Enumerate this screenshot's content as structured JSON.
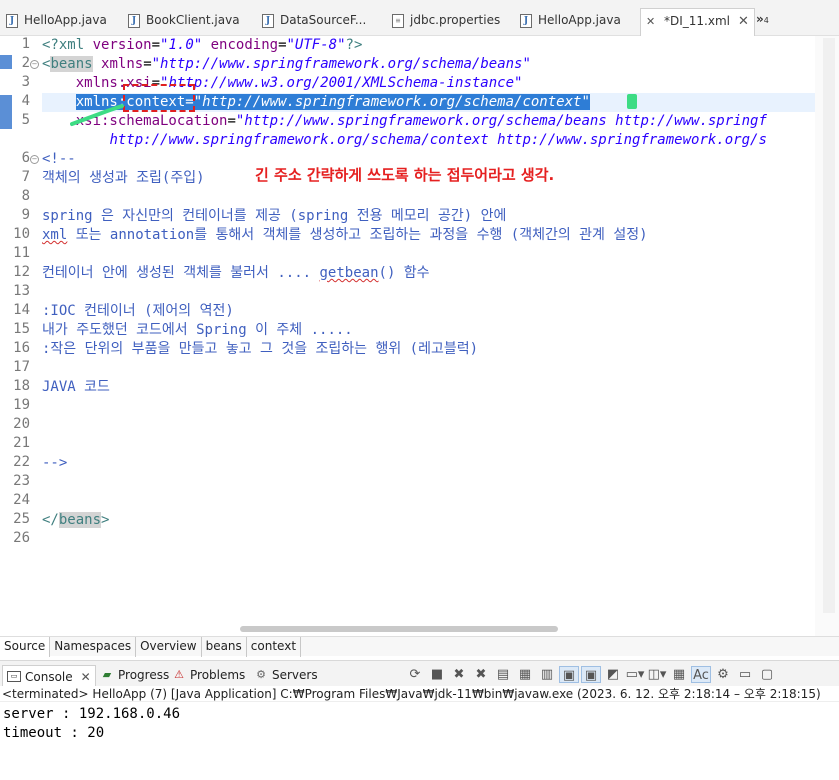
{
  "tabs": [
    {
      "label": "HelloApp.java",
      "icon": "java-file-icon"
    },
    {
      "label": "BookClient.java",
      "icon": "java-file-icon"
    },
    {
      "label": "DataSourceF...",
      "icon": "java-file-icon"
    },
    {
      "label": "jdbc.properties",
      "icon": "properties-file-icon"
    },
    {
      "label": "HelloApp.java",
      "icon": "java-file-icon"
    },
    {
      "label": "*DI_11.xml",
      "icon": "xml-file-icon",
      "active": true,
      "close": "✕"
    }
  ],
  "overflow": {
    "label": "»",
    "count": "4"
  },
  "editor": {
    "line_numbers": [
      "1",
      "2",
      "3",
      "4",
      "5",
      "6",
      "7",
      "8",
      "9",
      "10",
      "11",
      "12",
      "13",
      "14",
      "15",
      "16",
      "17",
      "18",
      "19",
      "20",
      "21",
      "22",
      "23",
      "24",
      "25",
      "26"
    ],
    "line1": {
      "a": "<?xml ",
      "b": "version",
      "c": "=",
      "d": "\"1.0\"",
      "e": " ",
      "f": "encoding",
      "g": "=",
      "h": "\"UTF-8\"",
      "i": "?>"
    },
    "line2": {
      "a": "<",
      "b": "beans",
      "c": " ",
      "d": "xmlns",
      "e": "=",
      "f": "\"http://www.springframework.org/schema/beans\""
    },
    "line3": {
      "a": "    ",
      "b": "xmlns:xsi",
      "c": "=",
      "d": "\"http://www.w3.org/2001/XMLSchema-instance\""
    },
    "line4": {
      "a": "    ",
      "b": "xmlns:context",
      "c": "=",
      "d": "\"http://www.springframework.org/schema/context\""
    },
    "line5": {
      "a": "    ",
      "b": "xsi:schemaLocation",
      "c": "=",
      "d": "\"http://www.springframework.org/schema/beans http://www.springf"
    },
    "line5b": {
      "a": "        ",
      "d": "http://www.springframework.org/schema/context http://www.springframework.org/s"
    },
    "line6": "<!--",
    "line7": "객체의 생성과 조립(주입)",
    "line8": "",
    "line9": "spring 은 자신만의 컨테이너를 제공 (spring 전용 메모리 공간) 안에",
    "line10a": "xml",
    "line10b": " 또는 annotation를 통해서 객체를 생성하고 조립하는 과정을 수행 (객체간의 관계 설정)",
    "line11": "",
    "line12a": "컨테이너 안에 생성된 객체를 불러서 .... ",
    "line12b": "getbean",
    "line12c": "() 함수",
    "line13": "",
    "line14": ":IOC 컨테이너 (제어의 역전)",
    "line15": "내가 주도했던 코드에서 Spring 이 주체 .....",
    "line16": ":작은 단위의 부품을 만들고 놓고 그 것을 조립하는 행위 (레고블럭)",
    "line17": "",
    "line18": "JAVA 코드",
    "line22": "-->",
    "line25a": "</",
    "line25b": "beans",
    "line25c": ">"
  },
  "annotation": "긴 주소 간략하게 쓰도록 하는 접두어라고 생각.",
  "source_tabs": [
    "Source",
    "Namespaces",
    "Overview",
    "beans",
    "context"
  ],
  "panel": {
    "tabs": [
      {
        "label": "Console",
        "icon": "console-icon",
        "active": true,
        "close": "✕"
      },
      {
        "label": "Progress",
        "icon": "progress-icon"
      },
      {
        "label": "Problems",
        "icon": "problems-icon"
      },
      {
        "label": "Servers",
        "icon": "servers-icon"
      }
    ],
    "header": "<terminated> HelloApp (7) [Java Application] C:₩Program Files₩Java₩jdk-11₩bin₩javaw.exe  (2023. 6. 12. 오후 2:18:14 – 오후 2:18:15)",
    "output": [
      "server : 192.168.0.46",
      "timeout : 20"
    ]
  },
  "colors": {
    "tag": "#3f7f7f",
    "attr": "#7f007f",
    "value": "#2a00ff",
    "comment": "#3f5fbf",
    "selection": "#2e7dd6",
    "annotation": "#e52020"
  }
}
